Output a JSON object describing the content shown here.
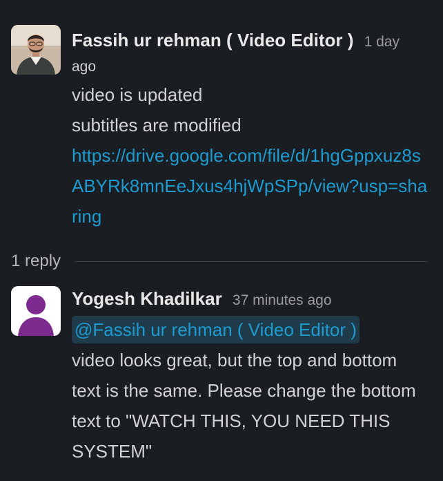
{
  "messages": [
    {
      "author": "Fassih ur rehman ( Video Editor )",
      "time_part1": "1 day",
      "time_part2": "ago",
      "lines": [
        "video is updated",
        "subtitles are modified"
      ],
      "link": "https://drive.google.com/file/d/1hgGppxuz8sABYRk8mnEeJxus4hjWpSPp/view?usp=sharing"
    },
    {
      "author": "Yogesh Khadilkar",
      "time": "37 minutes ago",
      "mention": "@Fassih ur rehman ( Video Editor )",
      "text": "video looks great, but the top and bottom text is the same. Please change the bottom text to \"WATCH THIS, YOU NEED THIS SYSTEM\""
    }
  ],
  "thread": {
    "reply_count_label": "1 reply"
  },
  "colors": {
    "background": "#1a1d21",
    "link": "#1d9bd1",
    "mention_bg": "#1f3b4a",
    "default_avatar_bg": "#ffffff",
    "default_avatar_fg": "#7d2b8f"
  }
}
